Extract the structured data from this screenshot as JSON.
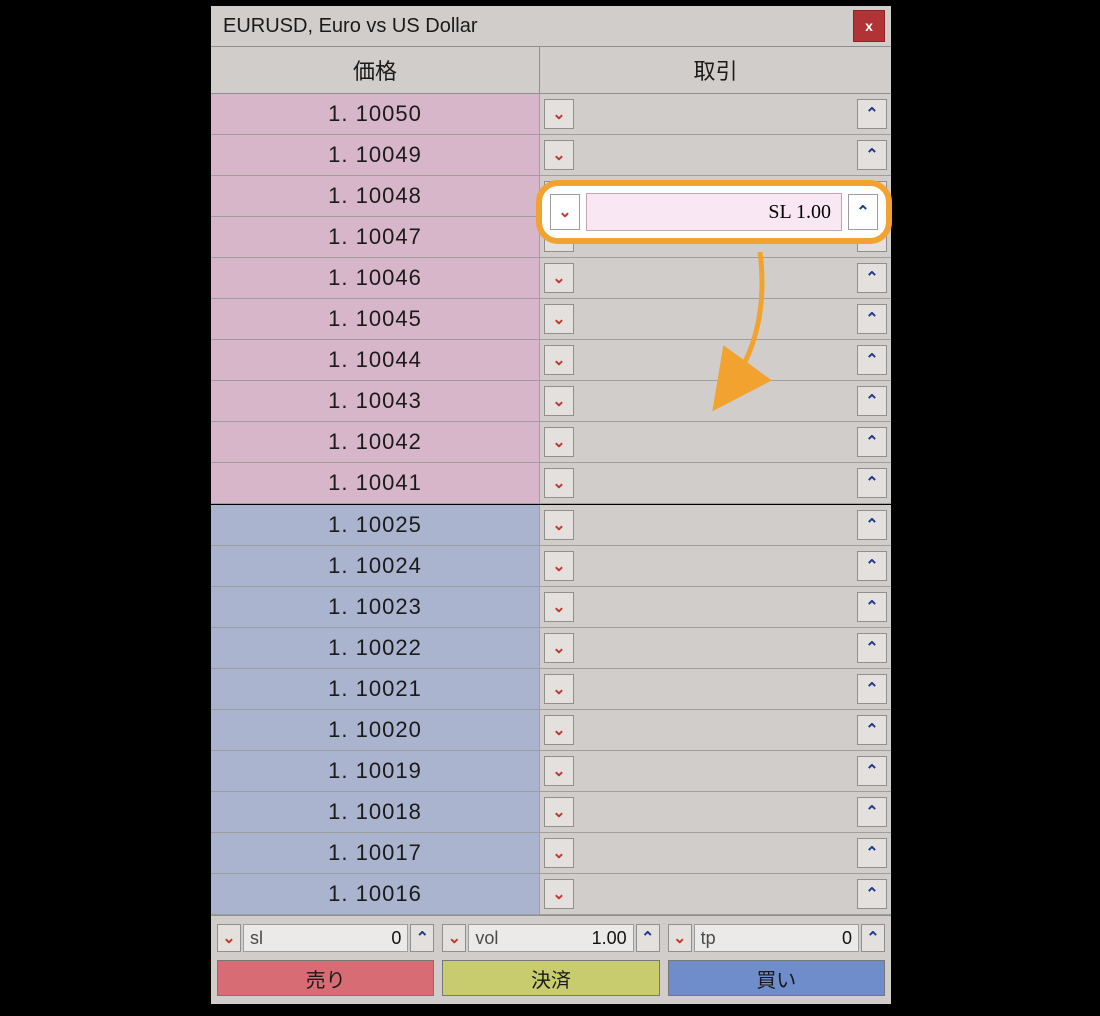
{
  "title": "EURUSD, Euro vs US Dollar",
  "close_label": "x",
  "headers": {
    "price": "価格",
    "trade": "取引"
  },
  "ask_prices": [
    "1. 10050",
    "1. 10049",
    "1. 10048",
    "1. 10047",
    "1. 10046",
    "1. 10045",
    "1. 10044",
    "1. 10043",
    "1. 10042",
    "1. 10041"
  ],
  "bid_prices": [
    "1. 10025",
    "1. 10024",
    "1. 10023",
    "1. 10022",
    "1. 10021",
    "1. 10020",
    "1. 10019",
    "1. 10018",
    "1. 10017",
    "1. 10016"
  ],
  "callout": {
    "label": "SL 1.00"
  },
  "inputs": {
    "sl": {
      "label": "sl",
      "value": "0"
    },
    "vol": {
      "label": "vol",
      "value": "1.00"
    },
    "tp": {
      "label": "tp",
      "value": "0"
    }
  },
  "actions": {
    "sell": "売り",
    "settle": "決済",
    "buy": "買い"
  }
}
